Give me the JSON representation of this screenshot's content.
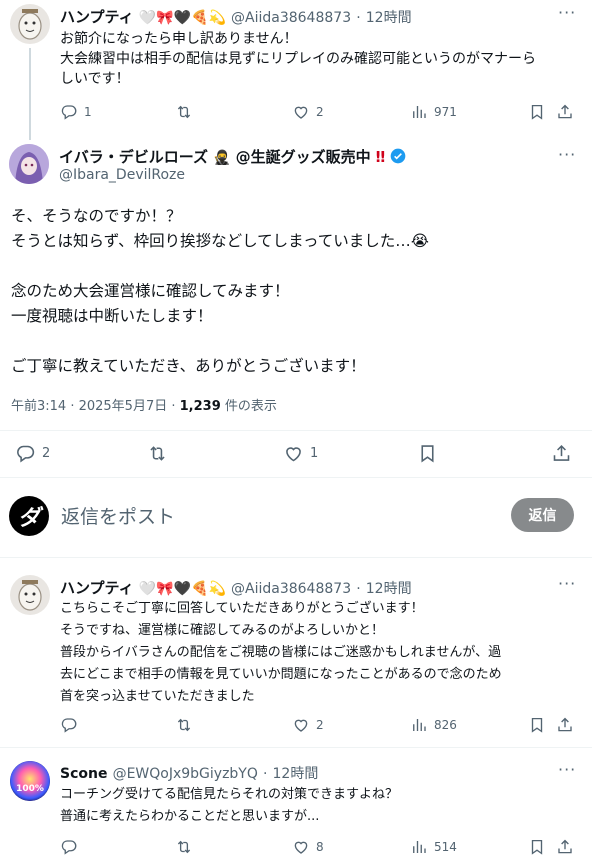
{
  "tweet1": {
    "name": "ハンプティ",
    "emojis": "🤍🎀🖤🍕💫",
    "handle": "@Aiida38648873",
    "time": "12時間",
    "lines": [
      "お節介になったら申し訳ありません！",
      "大会練習中は相手の配信は見ずにリプレイのみ確認可能というのがマナーら",
      "しいです！"
    ],
    "replies": "1",
    "likes": "2",
    "views": "971"
  },
  "main": {
    "name": "イバラ・デビルローズ",
    "name_suffix": "@生誕グッズ販売中",
    "handle": "@Ibara_DevilRoze",
    "p1": [
      "そ、そうなのですか！？",
      "そうとは知らず、枠回り挨拶などしてしまっていました…😭"
    ],
    "p2": [
      "念のため大会運営様に確認してみます！",
      "一度視聴は中断いたします！"
    ],
    "p3": [
      "ご丁寧に教えていただき、ありがとうございます！"
    ],
    "meta_time": "午前3:14 · 2025年5月7日 · ",
    "views_count": "1,239",
    "views_label": " 件の表示",
    "replies": "2",
    "likes": "1"
  },
  "reply_box": {
    "placeholder": "返信をポスト",
    "button": "返信"
  },
  "tweet2": {
    "name": "ハンプティ",
    "emojis": "🤍🎀🖤🍕💫",
    "handle": "@Aiida38648873",
    "time": "12時間",
    "lines": [
      "こちらこそご丁寧に回答していただきありがとうございます！",
      "そうですね、運営様に確認してみるのがよろしいかと！",
      "普段からイバラさんの配信をご視聴の皆様にはご迷惑かもしれませんが、過",
      "去にどこまで相手の情報を見ていいか問題になったことがあるので念のため",
      "首を突っ込ませていただきました"
    ],
    "likes": "2",
    "views": "826"
  },
  "tweet3": {
    "name": "Scone",
    "handle": "@EWQoJx9bGiyzbYQ",
    "time": "12時間",
    "avatar_text": "100%",
    "lines": [
      "コーチング受けてる配信見たらそれの対策できますよね？",
      "普通に考えたらわかることだと思いますが..."
    ],
    "likes": "8",
    "views": "514"
  },
  "colors": {
    "verified": "#1d9bf0",
    "text": "#0f1419",
    "muted": "#536471",
    "button": "#878a8c"
  }
}
